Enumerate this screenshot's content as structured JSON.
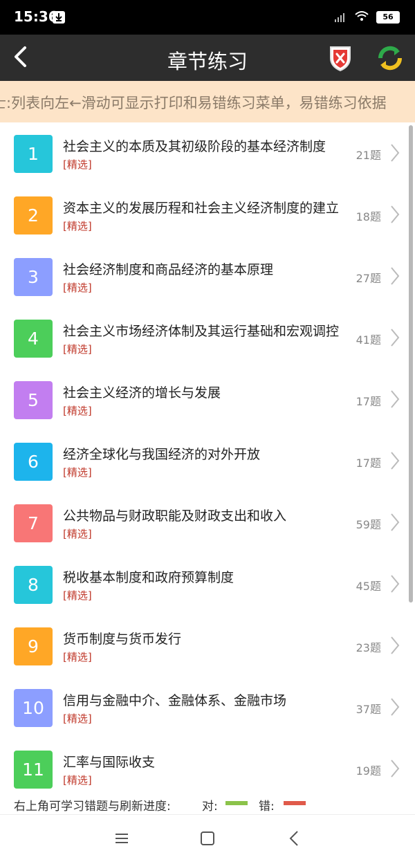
{
  "status": {
    "time": "15:36",
    "battery": "56"
  },
  "header": {
    "title": "章节练习"
  },
  "tip": {
    "text": "士:列表向左←滑动可显示打印和易错练习菜单，易错练习依据"
  },
  "chapters": [
    {
      "num": "1",
      "title": "社会主义的本质及其初级阶段的基本经济制度",
      "tag": "[精选]",
      "count": "21题",
      "color": "#26c6da"
    },
    {
      "num": "2",
      "title": "资本主义的发展历程和社会主义经济制度的建立",
      "tag": "[精选]",
      "count": "18题",
      "color": "#ffa726"
    },
    {
      "num": "3",
      "title": "社会经济制度和商品经济的基本原理",
      "tag": "[精选]",
      "count": "27题",
      "color": "#8c9eff"
    },
    {
      "num": "4",
      "title": "社会主义市场经济体制及其运行基础和宏观调控",
      "tag": "[精选]",
      "count": "41题",
      "color": "#4cce5a"
    },
    {
      "num": "5",
      "title": "社会主义经济的增长与发展",
      "tag": "[精选]",
      "count": "17题",
      "color": "#c27ef0"
    },
    {
      "num": "6",
      "title": "经济全球化与我国经济的对外开放",
      "tag": "[精选]",
      "count": "17题",
      "color": "#1db4ec"
    },
    {
      "num": "7",
      "title": "公共物品与财政职能及财政支出和收入",
      "tag": "[精选]",
      "count": "59题",
      "color": "#f87676"
    },
    {
      "num": "8",
      "title": "税收基本制度和政府预算制度",
      "tag": "[精选]",
      "count": "45题",
      "color": "#26c6da"
    },
    {
      "num": "9",
      "title": "货币制度与货币发行",
      "tag": "[精选]",
      "count": "23题",
      "color": "#ffa726"
    },
    {
      "num": "10",
      "title": "信用与金融中介、金融体系、金融市场",
      "tag": "[精选]",
      "count": "37题",
      "color": "#8c9eff"
    },
    {
      "num": "11",
      "title": "汇率与国际收支",
      "tag": "[精选]",
      "count": "19题",
      "color": "#4cce5a"
    }
  ],
  "legend": {
    "hint": "右上角可学习错题与刷新进度:",
    "correct_label": "对:",
    "wrong_label": "错:",
    "correct_color": "#8bc34a",
    "wrong_color": "#e05a4a"
  }
}
